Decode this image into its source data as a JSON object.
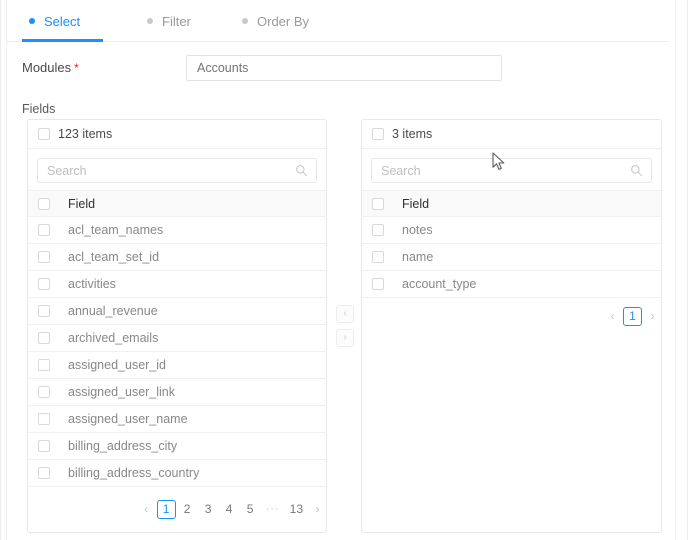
{
  "steps": [
    {
      "label": "Select",
      "state": "active",
      "dot": "bullet-dot-icon"
    },
    {
      "label": "Filter",
      "state": "inactive",
      "dot": "bullet-dot-icon"
    },
    {
      "label": "Order By",
      "state": "inactive",
      "dot": "bullet-dot-icon"
    }
  ],
  "form": {
    "modules_label": "Modules",
    "required_marker": "*",
    "modules_value": "Accounts",
    "modules_placeholder": "Accounts",
    "fields_label": "Fields"
  },
  "left_panel": {
    "count_label": "123 items",
    "search_placeholder": "Search",
    "search_value": "",
    "column_header": "Field",
    "items": [
      "acl_team_names",
      "acl_team_set_id",
      "activities",
      "annual_revenue",
      "archived_emails",
      "assigned_user_id",
      "assigned_user_link",
      "assigned_user_name",
      "billing_address_city",
      "billing_address_country"
    ],
    "pagination": {
      "prev": "‹",
      "next": "›",
      "ellipsis": "···",
      "pages": [
        "1",
        "2",
        "3",
        "4",
        "5"
      ],
      "last_page": "13",
      "current": "1"
    }
  },
  "right_panel": {
    "count_label": "3 items",
    "search_placeholder": "Search",
    "search_value": "",
    "column_header": "Field",
    "items": [
      "notes",
      "name",
      "account_type"
    ],
    "pagination": {
      "prev": "‹",
      "next": "›",
      "pages": [
        "1"
      ],
      "current": "1"
    }
  },
  "transfer": {
    "to_left_label": "‹",
    "to_right_label": "›"
  },
  "colors": {
    "accent": "#1890ff",
    "required": "#f5222d",
    "muted_text": "#888888",
    "border": "#e8e8e8",
    "header_row_bg": "#fafafa"
  }
}
